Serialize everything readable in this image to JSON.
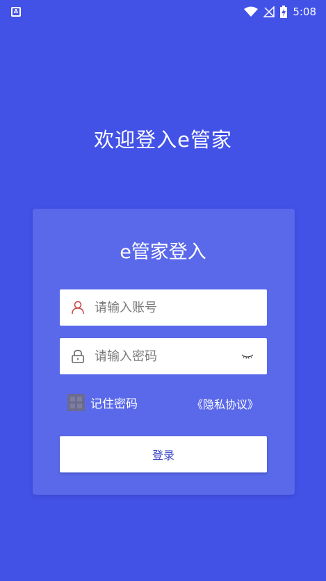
{
  "status_bar": {
    "time": "5:08",
    "app_icon_letter": "A",
    "icons": [
      "wifi-icon",
      "no-signal-icon",
      "battery-charging-icon"
    ]
  },
  "welcome_title": "欢迎登入e管家",
  "card": {
    "title": "e管家登入",
    "account_placeholder": "请输入账号",
    "account_value": "",
    "password_placeholder": "请输入密码",
    "password_value": "",
    "remember_label": "记住密码",
    "privacy_link": "《隐私协议》",
    "login_button": "登录"
  },
  "colors": {
    "background": "#4352e6",
    "card": "#5a69ea",
    "user_icon": "#c94a4a",
    "button_text": "#3b45c8"
  }
}
